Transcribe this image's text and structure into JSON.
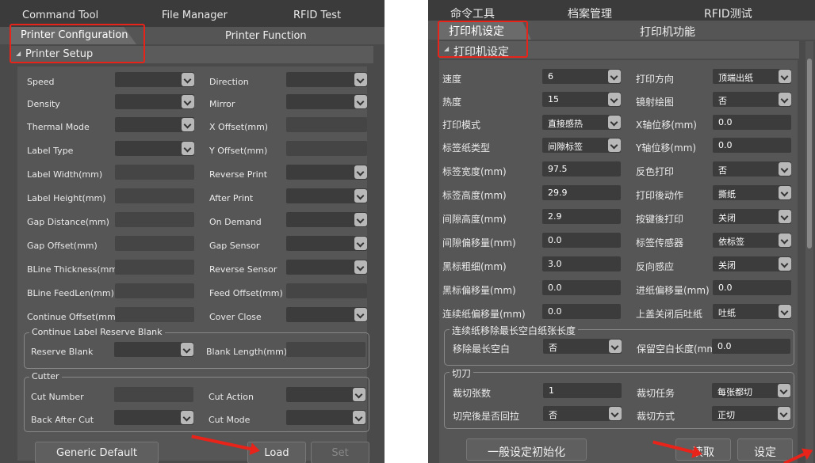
{
  "left": {
    "nav": [
      "Command Tool",
      "File Manager",
      "RFID Test"
    ],
    "tabs": [
      "Printer Configuration",
      "Printer Function"
    ],
    "section": "Printer Setup",
    "rows": [
      {
        "l": "Speed",
        "lv": "",
        "r": "Direction",
        "rv": ""
      },
      {
        "l": "Density",
        "lv": "",
        "r": "Mirror",
        "rv": ""
      },
      {
        "l": "Thermal Mode",
        "lv": "",
        "r": "X Offset(mm)",
        "rv": ""
      },
      {
        "l": "Label Type",
        "lv": "",
        "r": "Y Offset(mm)",
        "rv": ""
      },
      {
        "l": "Label Width(mm)",
        "lv": "",
        "r": "Reverse Print",
        "rv": ""
      },
      {
        "l": "Label Height(mm)",
        "lv": "",
        "r": "After Print",
        "rv": ""
      },
      {
        "l": "Gap Distance(mm)",
        "lv": "",
        "r": "On Demand",
        "rv": ""
      },
      {
        "l": "Gap Offset(mm)",
        "lv": "",
        "r": "Gap Sensor",
        "rv": ""
      },
      {
        "l": "BLine Thickness(mm)",
        "lv": "",
        "r": "Reverse Sensor",
        "rv": ""
      },
      {
        "l": "BLine FeedLen(mm)",
        "lv": "",
        "r": "Feed Offset(mm)",
        "rv": ""
      },
      {
        "l": "Continue Offset(mm)",
        "lv": "",
        "r": "Cover Close",
        "rv": ""
      }
    ],
    "group1": {
      "title": "Continue Label Reserve Blank",
      "l": "Reserve Blank",
      "lv": "",
      "r": "Blank Length(mm)",
      "rv": ""
    },
    "group2": {
      "title": "Cutter",
      "rows": [
        {
          "l": "Cut Number",
          "lv": "",
          "r": "Cut Action",
          "rv": ""
        },
        {
          "l": "Back After Cut",
          "lv": "",
          "r": "Cut Mode",
          "rv": ""
        }
      ]
    },
    "buttons": {
      "default": "Generic Default",
      "load": "Load",
      "set": "Set"
    }
  },
  "right": {
    "nav": [
      "命令工具",
      "档案管理",
      "RFID测试"
    ],
    "tabs": [
      "打印机设定",
      "打印机功能"
    ],
    "section": "打印机设定",
    "rows": [
      {
        "l": "速度",
        "lv": "6",
        "r": "打印方向",
        "rv": "顶端出纸"
      },
      {
        "l": "热度",
        "lv": "15",
        "r": "镜射绘图",
        "rv": "否"
      },
      {
        "l": "打印模式",
        "lv": "直接感热",
        "r": "X轴位移(mm)",
        "rv": "0.0"
      },
      {
        "l": "标签纸类型",
        "lv": "间隙标签",
        "r": "Y轴位移(mm)",
        "rv": "0.0"
      },
      {
        "l": "标签宽度(mm)",
        "lv": "97.5",
        "r": "反色打印",
        "rv": "否"
      },
      {
        "l": "标签高度(mm)",
        "lv": "29.9",
        "r": "打印後动作",
        "rv": "撕纸"
      },
      {
        "l": "间隙高度(mm)",
        "lv": "2.9",
        "r": "按键後打印",
        "rv": "关闭"
      },
      {
        "l": "间隙偏移量(mm)",
        "lv": "0.0",
        "r": "标签传感器",
        "rv": "依标签"
      },
      {
        "l": "黑标粗细(mm)",
        "lv": "3.0",
        "r": "反向感应",
        "rv": "关闭"
      },
      {
        "l": "黑标偏移量(mm)",
        "lv": "0.0",
        "r": "进纸偏移量(mm)",
        "rv": "0.0"
      },
      {
        "l": "连续纸偏移量(mm)",
        "lv": "0.0",
        "r": "上盖关闭后吐纸",
        "rv": "吐纸"
      }
    ],
    "group1": {
      "title": "连续纸移除最长空白纸张长度",
      "l": "移除最长空白",
      "lv": "否",
      "r": "保留空白长度(mm)",
      "rv": "0.0"
    },
    "group2": {
      "title": "切刀",
      "rows": [
        {
          "l": "裁切张数",
          "lv": "1",
          "r": "裁切任务",
          "rv": "每张都切"
        },
        {
          "l": "切完後是否回拉",
          "lv": "否",
          "r": "裁切方式",
          "rv": "正切"
        }
      ]
    },
    "buttons": {
      "default": "一般设定初始化",
      "load": "读取",
      "set": "设定"
    }
  }
}
